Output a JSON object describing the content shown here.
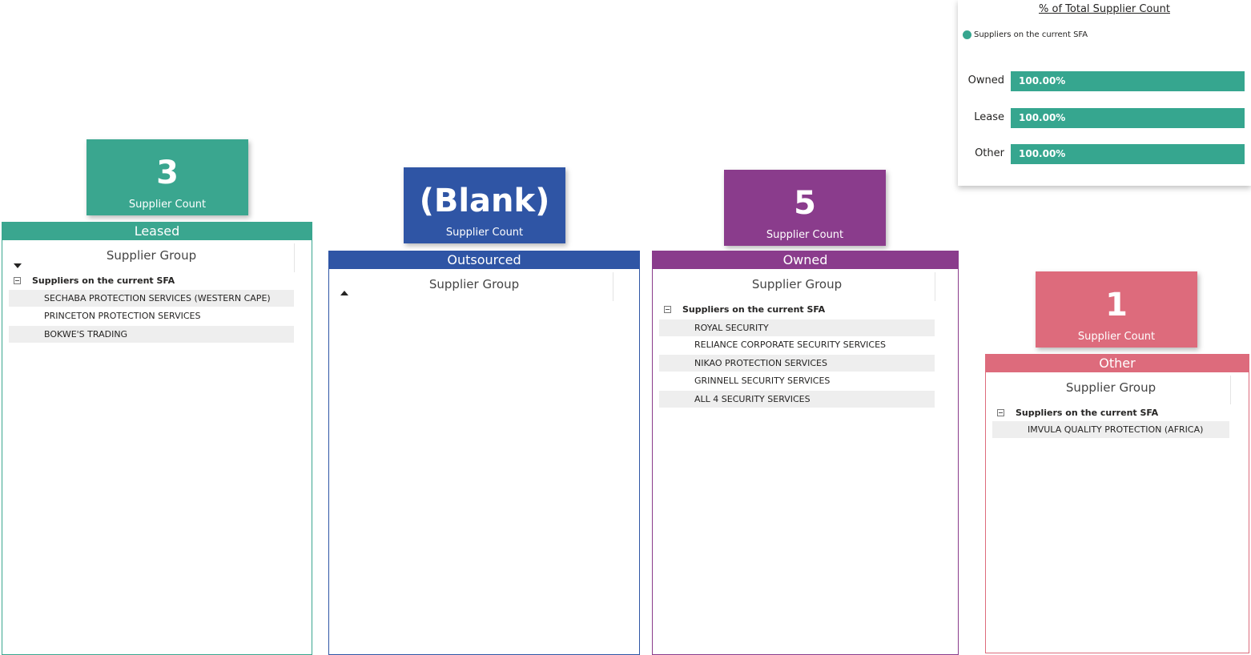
{
  "colors": {
    "leased": "#3aa68f",
    "outsourced": "#2f55a5",
    "owned": "#8a3c8c",
    "other": "#dd6b7c",
    "bar": "#36a68f"
  },
  "common": {
    "column_header": "Supplier Group",
    "group_label": "Suppliers on the current SFA",
    "card_caption": "Supplier Count"
  },
  "leased": {
    "count": "3",
    "title": "Leased",
    "rows": [
      "SECHABA PROTECTION SERVICES (WESTERN CAPE)",
      "PRINCETON PROTECTION SERVICES",
      "BOKWE'S TRADING"
    ]
  },
  "outsourced": {
    "count": "(Blank)",
    "title": "Outsourced",
    "rows": []
  },
  "owned": {
    "count": "5",
    "title": "Owned",
    "rows": [
      "ROYAL SECURITY",
      "RELIANCE CORPORATE SECURITY SERVICES",
      "NIKAO PROTECTION SERVICES",
      "GRINNELL SECURITY SERVICES",
      "ALL 4 SECURITY SERVICES"
    ]
  },
  "other": {
    "count": "1",
    "title": "Other",
    "rows": [
      "IMVULA QUALITY PROTECTION (AFRICA)"
    ]
  },
  "chart_data": {
    "type": "bar",
    "title": "% of Total Supplier Count",
    "categories": [
      "Owned",
      "Lease",
      "Other"
    ],
    "series": [
      {
        "name": "Suppliers on the current SFA",
        "values": [
          100,
          100,
          100
        ],
        "labels": [
          "100.00%",
          "100.00%",
          "100.00%"
        ]
      }
    ],
    "xlim": [
      0,
      100
    ],
    "legend": "top-left"
  }
}
